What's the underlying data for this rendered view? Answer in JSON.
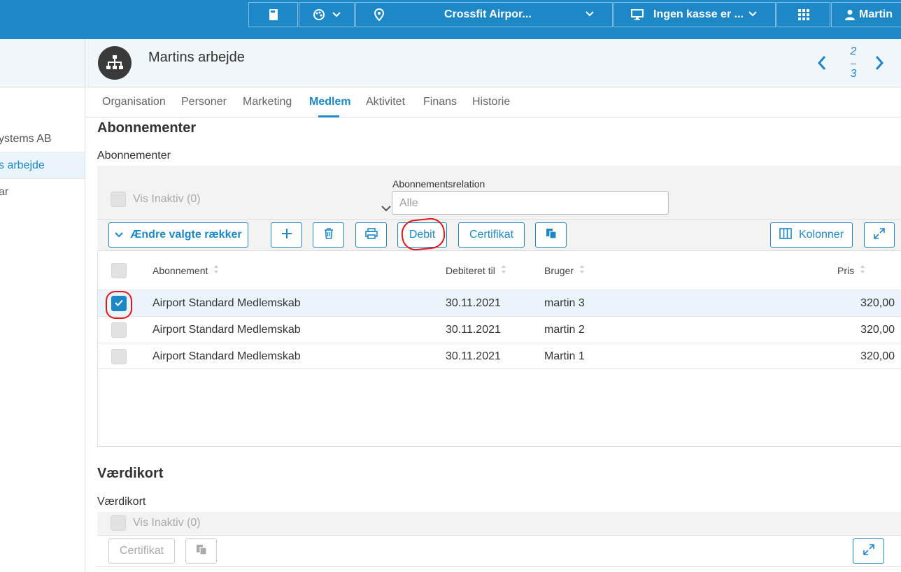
{
  "topbar": {
    "location": "Crossfit Airpor...",
    "register": "Ingen kasse er ...",
    "user": "Martin"
  },
  "sidebar": {
    "items": [
      {
        "label": "ystems AB"
      },
      {
        "label": "s arbejde"
      },
      {
        "label": "ar"
      }
    ]
  },
  "header": {
    "title": "Martins arbejde",
    "pager_current": "2",
    "pager_total": "3"
  },
  "tabs": [
    {
      "label": "Organisation"
    },
    {
      "label": "Personer"
    },
    {
      "label": "Marketing"
    },
    {
      "label": "Medlem"
    },
    {
      "label": "Aktivitet"
    },
    {
      "label": "Finans"
    },
    {
      "label": "Historie"
    }
  ],
  "subscriptions": {
    "section_title": "Abonnementer",
    "sub_title": "Abonnementer",
    "show_inactive": "Vis Inaktiv (0)",
    "relation_label": "Abonnementsrelation",
    "relation_value": "Alle",
    "toolbar": {
      "change_rows": "Ændre valgte rækker",
      "debit": "Debit",
      "certificate": "Certifikat",
      "columns": "Kolonner"
    },
    "columns": {
      "subscription": "Abonnement",
      "debited_to": "Debiteret til",
      "user": "Bruger",
      "price": "Pris"
    },
    "rows": [
      {
        "subscription": "Airport Standard Medlemskab",
        "debited_to": "30.11.2021",
        "user": "martin 3",
        "price": "320,00",
        "selected": true
      },
      {
        "subscription": "Airport Standard Medlemskab",
        "debited_to": "30.11.2021",
        "user": "martin 2",
        "price": "320,00",
        "selected": false
      },
      {
        "subscription": "Airport Standard Medlemskab",
        "debited_to": "30.11.2021",
        "user": "Martin 1",
        "price": "320,00",
        "selected": false
      }
    ]
  },
  "value_cards": {
    "section_title": "Værdikort",
    "sub_title": "Værdikort",
    "show_inactive": "Vis Inaktiv (0)",
    "certificate": "Certifikat"
  },
  "colors": {
    "accent": "#1e88c7",
    "annotation": "#e0161b"
  }
}
